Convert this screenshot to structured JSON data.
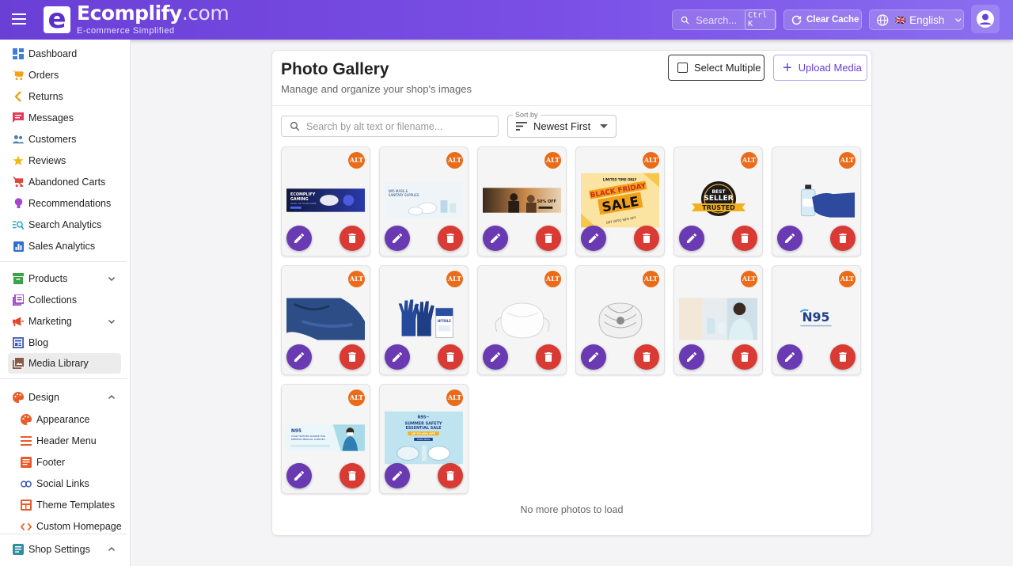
{
  "header": {
    "logo_letter": "e",
    "brand_main": "Ecomplify",
    "brand_suffix": ".com",
    "tagline": "E-commerce Simplified",
    "search_label": "Search...",
    "search_shortcut": "Ctrl K",
    "clear_cache_label": "Clear Cache",
    "language_flag": "🇬🇧",
    "language_label": "English"
  },
  "sidebar": {
    "items": [
      {
        "label": "Dashboard",
        "icon": "dashboard-icon"
      },
      {
        "label": "Orders",
        "icon": "cart-icon"
      },
      {
        "label": "Returns",
        "icon": "chevron-left-icon"
      },
      {
        "label": "Messages",
        "icon": "message-icon"
      },
      {
        "label": "Customers",
        "icon": "people-icon"
      },
      {
        "label": "Reviews",
        "icon": "star-icon"
      },
      {
        "label": "Abandoned Carts",
        "icon": "cart-off-icon"
      },
      {
        "label": "Recommendations",
        "icon": "lightbulb-icon"
      },
      {
        "label": "Search Analytics",
        "icon": "search-analytics-icon"
      },
      {
        "label": "Sales Analytics",
        "icon": "chart-icon"
      },
      {
        "label": "Products",
        "icon": "product-icon"
      },
      {
        "label": "Collections",
        "icon": "collection-icon"
      },
      {
        "label": "Marketing",
        "icon": "megaphone-icon"
      },
      {
        "label": "Blog",
        "icon": "blog-icon"
      },
      {
        "label": "Media Library",
        "icon": "image-icon"
      },
      {
        "label": "Design",
        "icon": "palette-icon"
      },
      {
        "label": "Appearance",
        "icon": "palette-icon"
      },
      {
        "label": "Header Menu",
        "icon": "menu-icon"
      },
      {
        "label": "Footer",
        "icon": "footer-icon"
      },
      {
        "label": "Social Links",
        "icon": "link-icon"
      },
      {
        "label": "Theme Templates",
        "icon": "template-icon"
      },
      {
        "label": "Custom Homepage",
        "icon": "code-icon"
      },
      {
        "label": "Shop Settings",
        "icon": "settings-icon"
      }
    ]
  },
  "page": {
    "title": "Photo Gallery",
    "subtitle": "Manage and organize your shop's images",
    "select_multiple_label": "Select Multiple",
    "upload_label": "Upload Media",
    "search_placeholder": "Search by alt text or filename...",
    "sort_label": "Sort by",
    "sort_value": "Newest First",
    "end_message": "No more photos to load"
  },
  "gallery": {
    "badge_label": "ALT",
    "photos": [
      {
        "kind": "banner-gaming",
        "text": [
          "ECOMPLIFY",
          "GAMING",
          "LEVEL UP YOUR GAME"
        ]
      },
      {
        "kind": "banner-masks",
        "text": [
          "N95 MASK &",
          "SANITARY SUPPLIES"
        ]
      },
      {
        "kind": "banner-dark",
        "text": [
          "50% OFF"
        ]
      },
      {
        "kind": "black-friday",
        "text": [
          "LIMITED TIME ONLY",
          "BLACK FRIDAY",
          "SALE",
          "GET UPTO 50% OFF"
        ]
      },
      {
        "kind": "best-seller",
        "text": [
          "BEST",
          "SELLER",
          "TRUSTED"
        ]
      },
      {
        "kind": "gloved-bottle",
        "text": []
      },
      {
        "kind": "blue-gloves",
        "text": []
      },
      {
        "kind": "glove-box",
        "text": [
          "NITRILE"
        ]
      },
      {
        "kind": "mask-white",
        "text": []
      },
      {
        "kind": "mask-grey",
        "text": []
      },
      {
        "kind": "nurse-photo",
        "text": []
      },
      {
        "kind": "n95-logo",
        "text": [
          "N95"
        ]
      },
      {
        "kind": "banner-n95",
        "text": [
          "N95",
          "YOUR TRUSTED SOURCE FOR",
          "PREMIUM MEDICAL SUPPLIES"
        ]
      },
      {
        "kind": "summer-sale",
        "text": [
          "N95~",
          "SUMMER SAFETY",
          "ESSENTIAL SALE",
          "UP TO 40% OFF",
          "SHOP NOW"
        ]
      }
    ]
  },
  "colors": {
    "brand": "#6a3fd6",
    "edit_button": "#6a3ab2",
    "delete_button": "#d93a33",
    "alt_badge": "#ea6c1a"
  }
}
